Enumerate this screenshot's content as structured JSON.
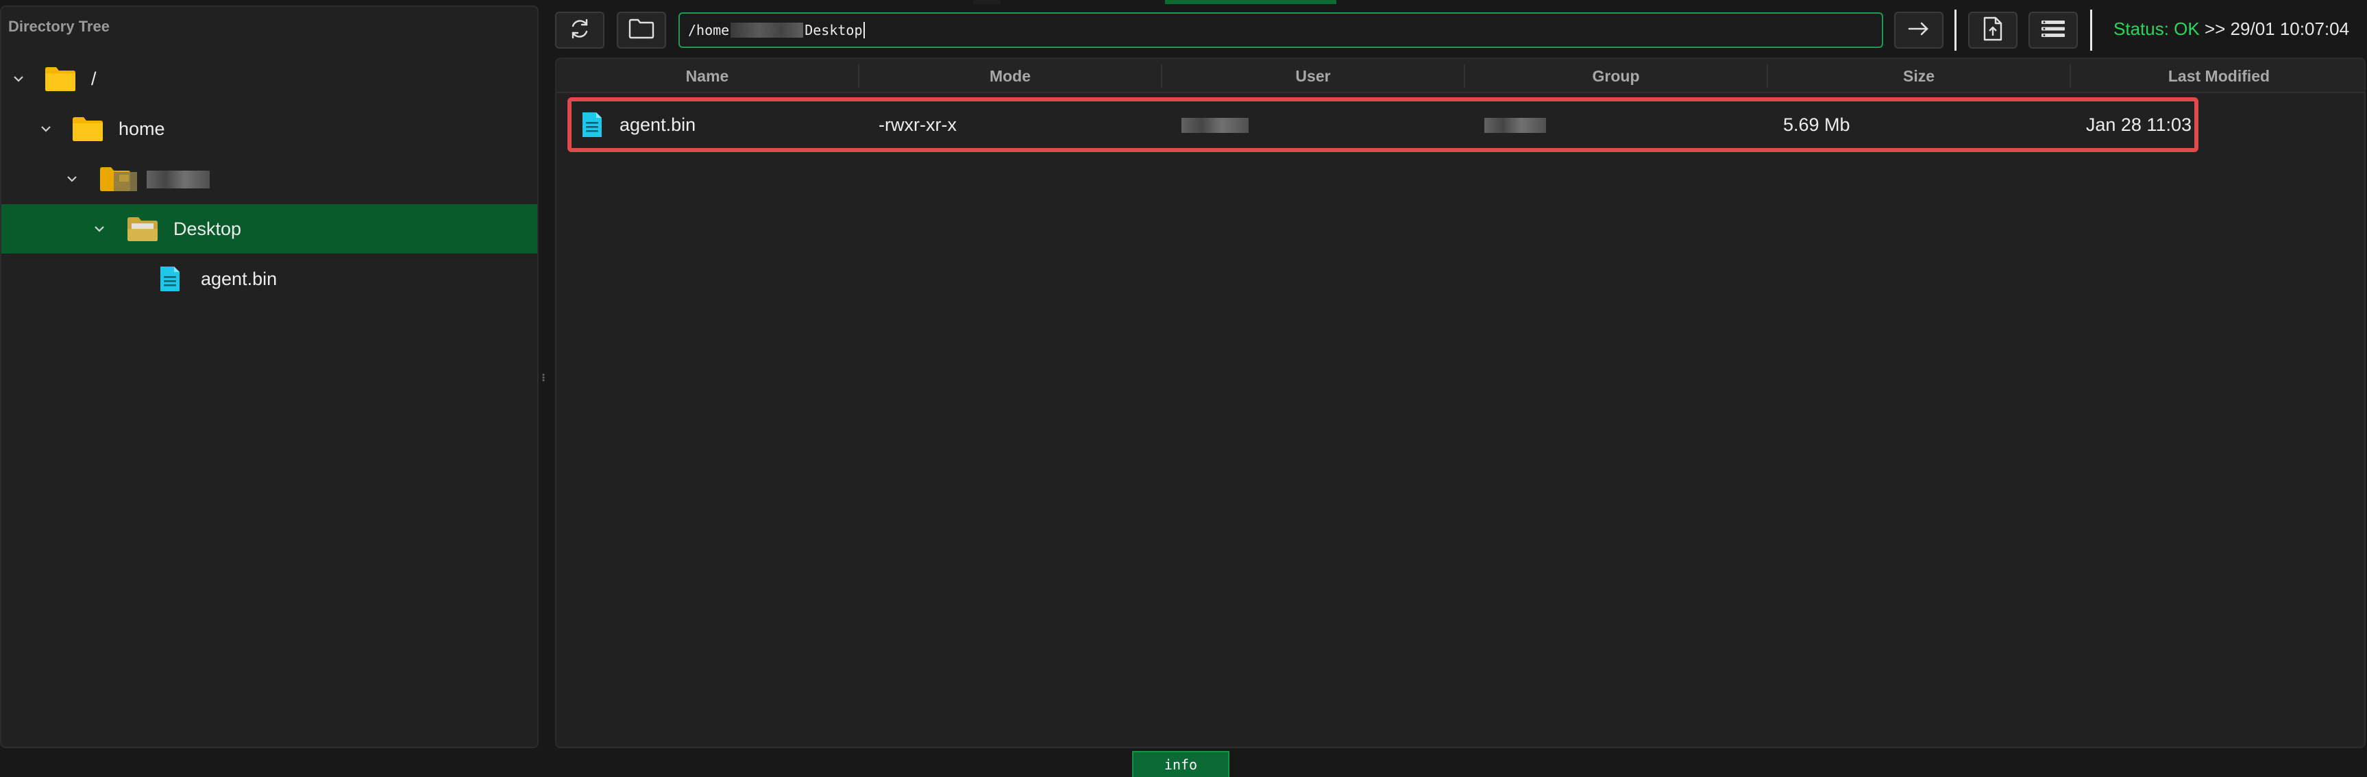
{
  "left_panel": {
    "title": "Directory Tree",
    "tree": [
      {
        "label": "/",
        "icon": "folder-icon",
        "expanded": true
      },
      {
        "label": "home",
        "icon": "folder-icon",
        "expanded": true
      },
      {
        "label": "",
        "icon": "folder-icon",
        "expanded": true,
        "redacted": true
      },
      {
        "label": "Desktop",
        "icon": "folder-open-icon",
        "expanded": true,
        "selected": true
      },
      {
        "label": "agent.bin",
        "icon": "file-icon"
      }
    ]
  },
  "toolbar": {
    "path_prefix": "/home",
    "path_suffix": "Desktop",
    "status_label": "Status: OK",
    "status_rest": ">> 29/01 10:07:04"
  },
  "table": {
    "columns": [
      "Name",
      "Mode",
      "User",
      "Group",
      "Size",
      "Last Modified"
    ],
    "rows": [
      {
        "name": "agent.bin",
        "mode": "-rwxr-xr-x",
        "user": "",
        "group": "",
        "size": "5.69 Mb",
        "modified": "Jan 28 11:03"
      }
    ]
  },
  "bottom_tab": {
    "label": "info"
  },
  "colors": {
    "accent_green": "#085c2b",
    "status_ok": "#28d65a",
    "highlight_red": "#e2484c",
    "file_cyan": "#1ec8e8",
    "folder_yellow": "#f5b400"
  }
}
